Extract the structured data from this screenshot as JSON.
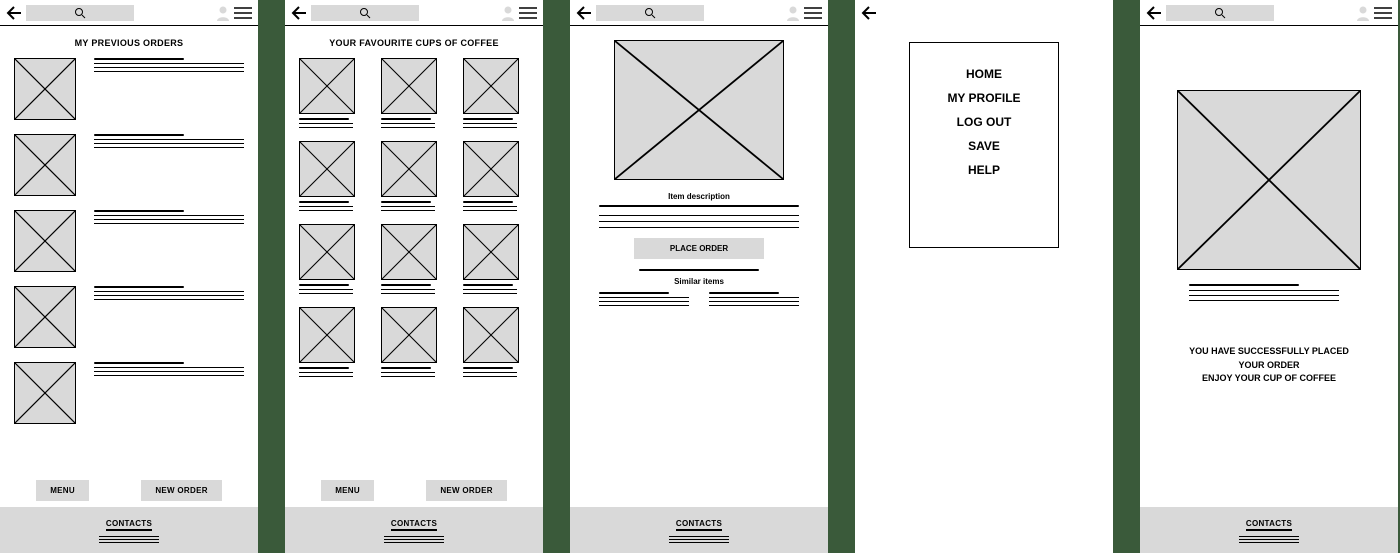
{
  "icons": {
    "search": "search-icon",
    "avatar": "avatar-icon",
    "menu": "hamburger-icon",
    "back": "back-arrow"
  },
  "screen1": {
    "title": "MY PREVIOUS ORDERS",
    "buttons": {
      "menu": "MENU",
      "new": "NEW ORDER"
    },
    "footer": "CONTACTS"
  },
  "screen2": {
    "title": "YOUR FAVOURITE CUPS OF COFFEE",
    "buttons": {
      "menu": "MENU",
      "new": "NEW ORDER"
    },
    "footer": "CONTACTS"
  },
  "screen3": {
    "item_description": "Item description",
    "place_order": "PLACE ORDER",
    "similar": "Similar items",
    "footer": "CONTACTS"
  },
  "screen4": {
    "menu": [
      "HOME",
      "MY PROFILE",
      "LOG OUT",
      "SAVE",
      "HELP"
    ]
  },
  "screen5": {
    "message_line1": "YOU HAVE SUCCESSFULLY PLACED",
    "message_line2": "YOUR ORDER",
    "message_line3": "ENJOY YOUR CUP OF COFFEE",
    "footer": "CONTACTS"
  }
}
